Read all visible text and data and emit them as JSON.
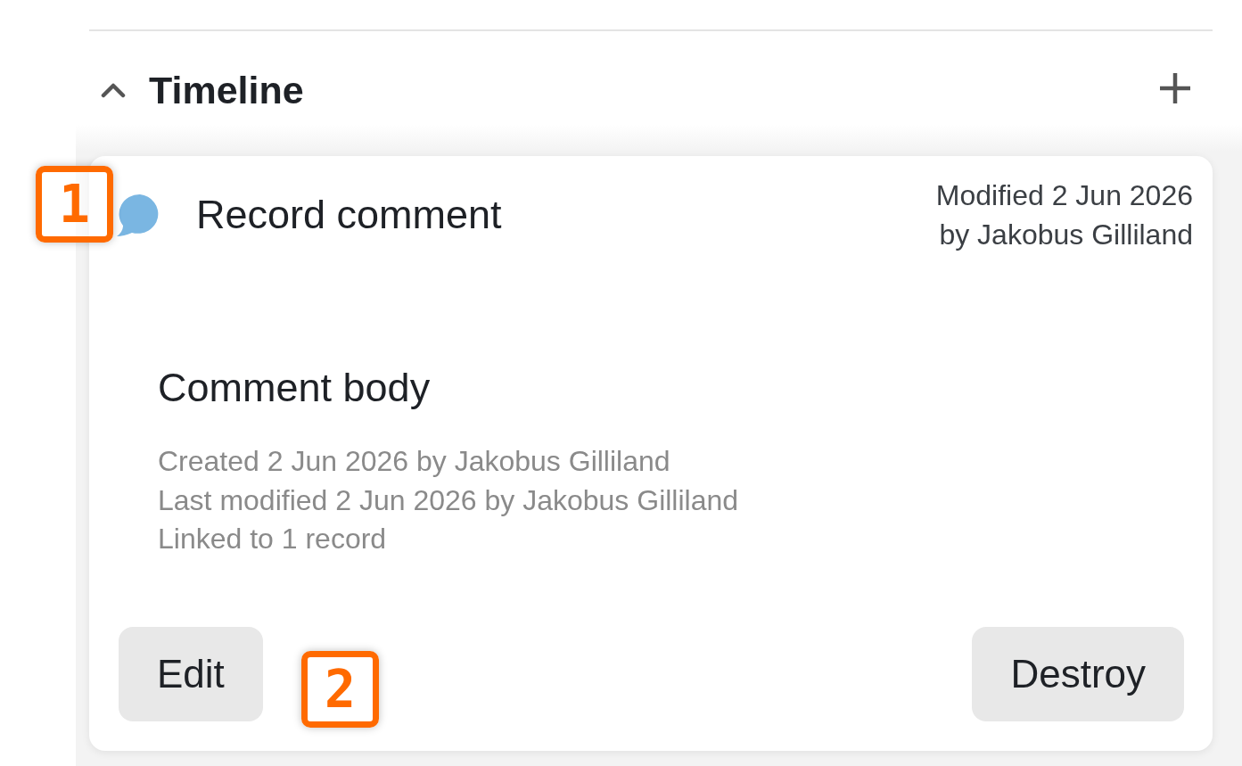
{
  "timeline": {
    "title": "Timeline",
    "expanded": true,
    "entries": [
      {
        "kind": "comment",
        "title": "Record comment",
        "modified": "Modified 2 Jun 2026 by Jakobus Gilliland",
        "body": "Comment body",
        "meta": [
          "Created 2 Jun 2026 by Jakobus Gilliland",
          "Last modified 2 Jun 2026 by Jakobus Gilliland",
          "Linked to 1 record"
        ],
        "actions": [
          "Edit",
          "Destroy"
        ]
      }
    ]
  },
  "annotations": [
    {
      "label": "1"
    },
    {
      "label": "2"
    }
  ]
}
